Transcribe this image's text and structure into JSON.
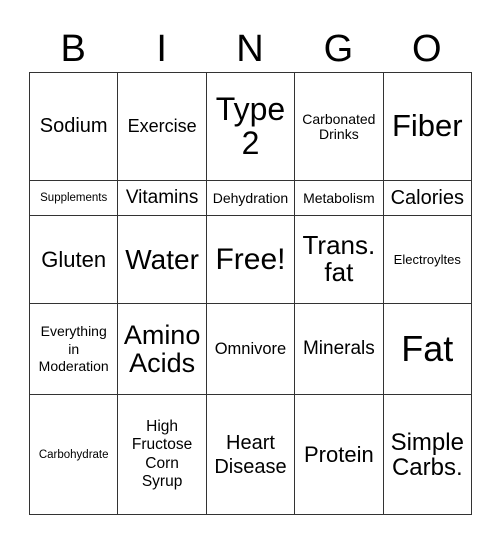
{
  "title_letters": [
    "B",
    "I",
    "N",
    "G",
    "O"
  ],
  "rows": [
    [
      "Sodium",
      "Exercise",
      "Type 2",
      "Carbonated Drinks",
      "Fiber"
    ],
    [
      "Supplements",
      "Vitamins",
      "Dehydration",
      "Metabolism",
      "Calories"
    ],
    [
      "Gluten",
      "Water",
      "Free!",
      "Trans. fat",
      "Electroyltes"
    ],
    [
      "Everything in Moderation",
      "Amino Acids",
      "Omnivore",
      "Minerals",
      "Fat"
    ],
    [
      "Carbohydrate",
      "High Fructose Corn Syrup",
      "Heart Disease",
      "Protein",
      "Simple Carbs."
    ]
  ]
}
